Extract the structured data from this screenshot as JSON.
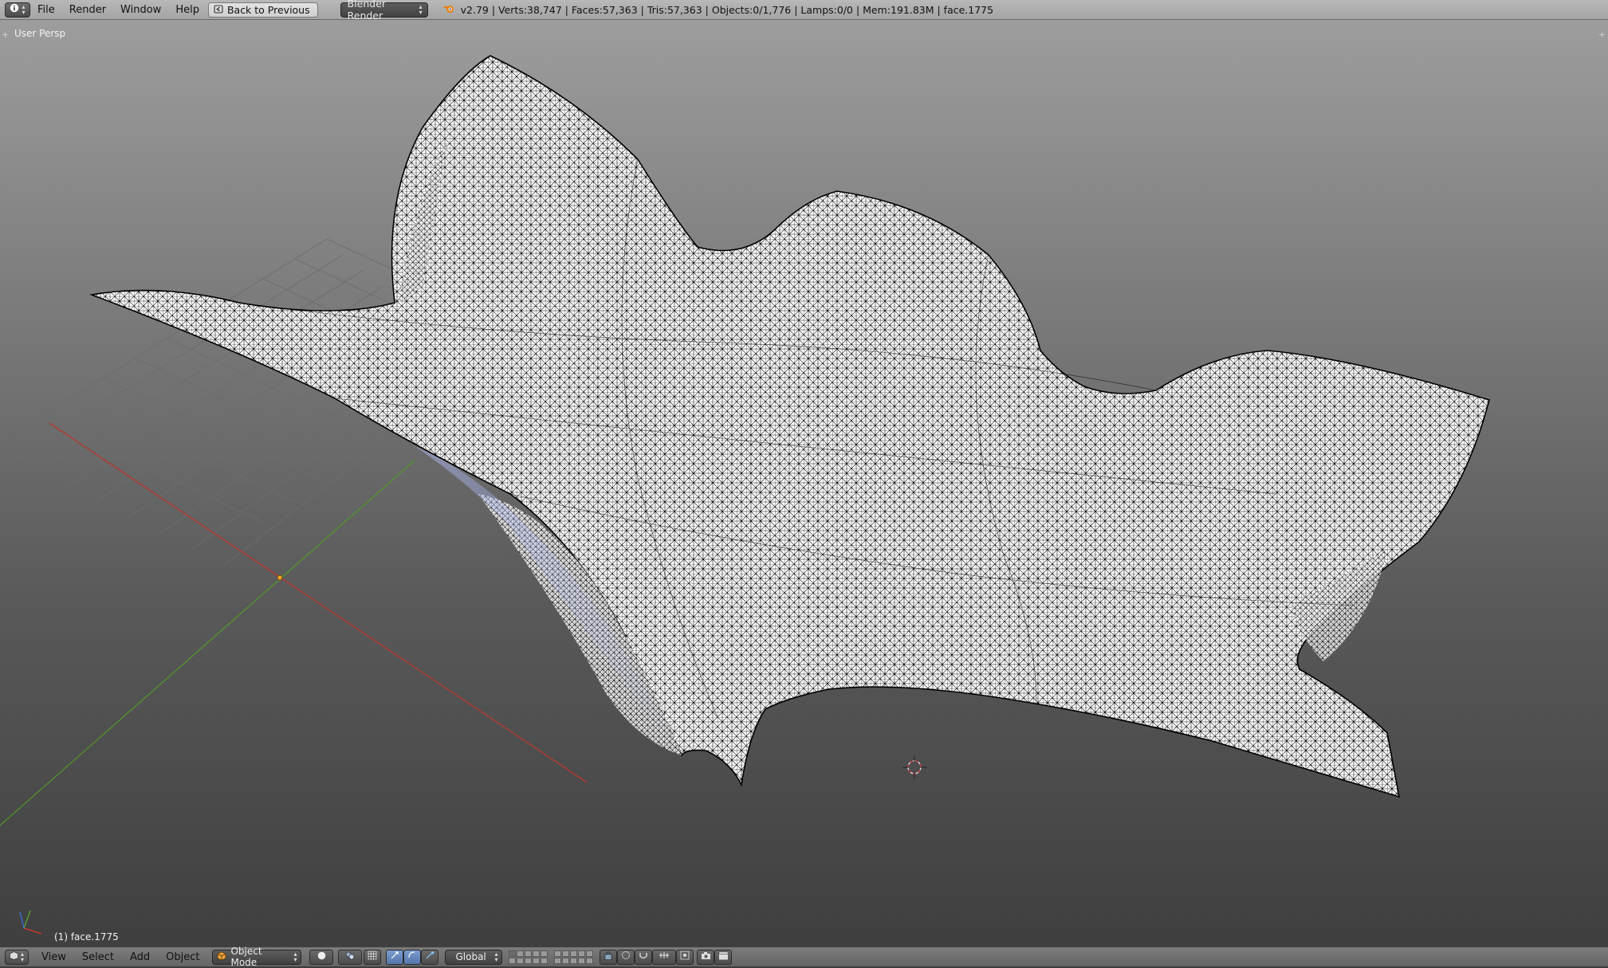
{
  "topbar": {
    "menus": [
      "File",
      "Render",
      "Window",
      "Help"
    ],
    "back_button": "Back to Previous",
    "render_engine": "Blender Render",
    "stats": "v2.79 | Verts:38,747 | Faces:57,363 | Tris:57,363 | Objects:0/1,776 | Lamps:0/0 | Mem:191.83M | face.1775"
  },
  "viewport": {
    "view_label": "User Persp",
    "object_label": "(1) face.1775",
    "mesh_color": "#ffffff",
    "wire_color": "#000000",
    "x_axis_color": "#c0392b",
    "y_axis_color": "#5aa02c"
  },
  "bottombar": {
    "menus": [
      "View",
      "Select",
      "Add",
      "Object"
    ],
    "mode": "Object Mode",
    "orientation": "Global"
  },
  "icons": {
    "editor_type": "info-icon",
    "back": "back-icon",
    "blender": "blender-logo-icon",
    "cube": "cube-icon",
    "cursor": "3d-cursor-icon"
  }
}
